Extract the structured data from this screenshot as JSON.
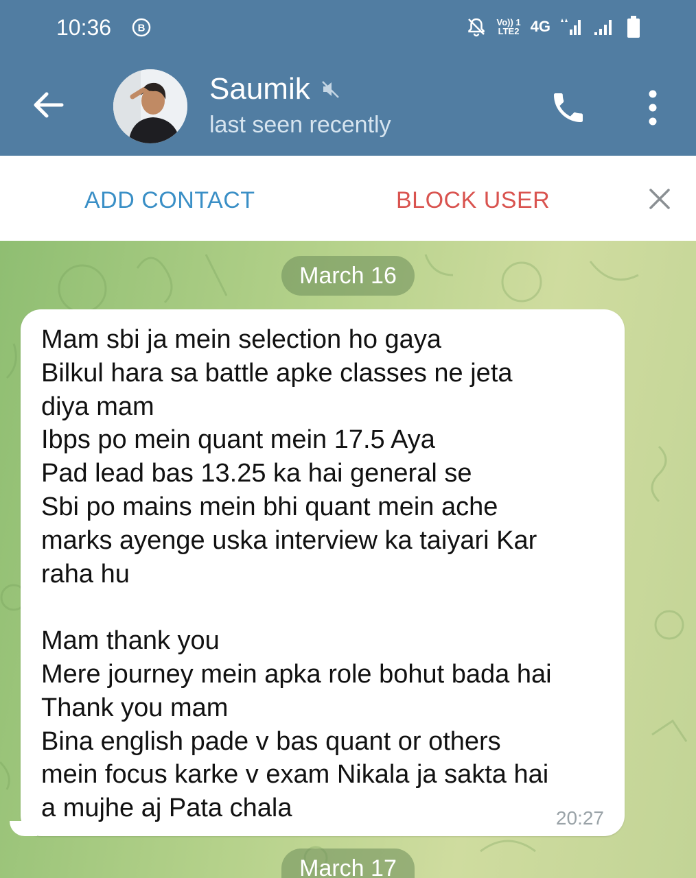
{
  "status_bar": {
    "time": "10:36",
    "b_icon": "B",
    "volte_line1": "Vo)) 1",
    "volte_line2": "LTE2",
    "network": "4G"
  },
  "header": {
    "name": "Saumik",
    "status": "last seen recently"
  },
  "action_bar": {
    "add_contact": "ADD CONTACT",
    "block_user": "BLOCK USER"
  },
  "chat": {
    "dates": [
      "March 16",
      "March 17"
    ],
    "message": {
      "lines": [
        "Mam sbi ja mein selection ho gaya",
        "Bilkul hara sa battle apke classes ne jeta",
        "diya mam",
        "Ibps po mein quant mein 17.5 Aya",
        "Pad lead bas 13.25 ka hai general se",
        "Sbi po mains mein bhi quant mein ache",
        "marks ayenge uska interview ka taiyari Kar",
        "raha hu",
        "",
        "Mam thank you",
        "Mere journey mein apka role bohut bada hai",
        "Thank you mam",
        "Bina english pade v bas quant or others",
        "mein focus karke v exam Nikala ja sakta hai",
        "a mujhe aj Pata chala"
      ],
      "time": "20:27"
    }
  },
  "colors": {
    "header": "#517da2",
    "add_contact": "#3a8fc6",
    "block_user": "#d9534f"
  },
  "icons": [
    "back-arrow-icon",
    "mute-icon",
    "phone-icon",
    "more-vert-icon",
    "close-icon",
    "notification-off-icon",
    "signal-icon",
    "battery-icon"
  ]
}
